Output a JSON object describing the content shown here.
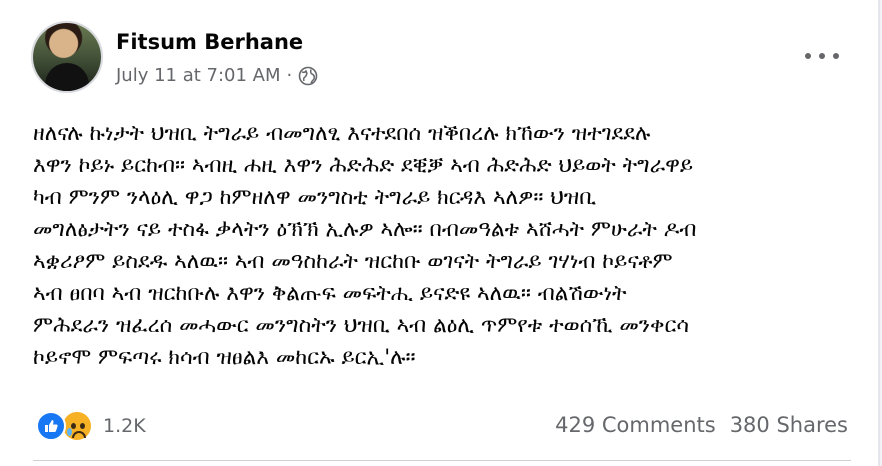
{
  "post": {
    "author": "Fitsum Berhane",
    "timestamp": "July 11 at 7:01 AM",
    "separator": "·",
    "privacy_icon": "globe-icon",
    "more_icon": "more-options-icon",
    "body_lines": [
      "ዘለናሉ ኩነታት ህዝቢ ትግራይ ብመግለፂ እናተደበሰ ዝቕበረሉ ክኸውን ዝተገደደሉ",
      "እዋን ኮይኑ ይርከብ። ኣብዚ ሐዚ እዋን ሕድሕድ ደቒቓ ኣብ ሕድሕድ ህይወት ትግራዋይ",
      "ካብ ምንም ንላዕሊ ዋጋ ከምዘለዋ መንግስቲ ትግራይ ክርዳእ ኣለዎ። ህዝቢ",
      "መግለፅታትን ናይ ተስፋ ቃላትን ዕኽኽ ኢሉዎ ኣሎ። በብመዓልቱ ኣሸሓት ምሁራት ዶብ",
      "ኣቋሪፆም ይስደዱ ኣለዉ። ኣብ መዓስከራት ዝርከቡ ወገናት ትግራይ ገሃነብ ኮይናቶም",
      "ኣብ ፀበባ ኣብ ዝርከቡሉ እዋን ቅልጡፍ መፍትሒ ይናድዩ ኣለዉ። ብልሽውነት",
      "ምሕደራን ዝፈረሰ መሓውር መንግስትን ህዝቢ ኣብ ልዕሊ ጥምየቱ ተወሰኺ መንቀርሳ",
      "ኮይኖሞ ምፍጣሩ ክሳብ ዝፀልእ መከርኡ ይርኢ'ሉ።"
    ]
  },
  "reactions": {
    "icons": [
      "like-icon",
      "sad-icon"
    ],
    "count": "1.2K"
  },
  "stats": {
    "comments": "429 Comments",
    "shares": "380 Shares"
  },
  "colors": {
    "like": "#1877f2",
    "sad": "#f7b125",
    "secondary_text": "#65676b"
  }
}
